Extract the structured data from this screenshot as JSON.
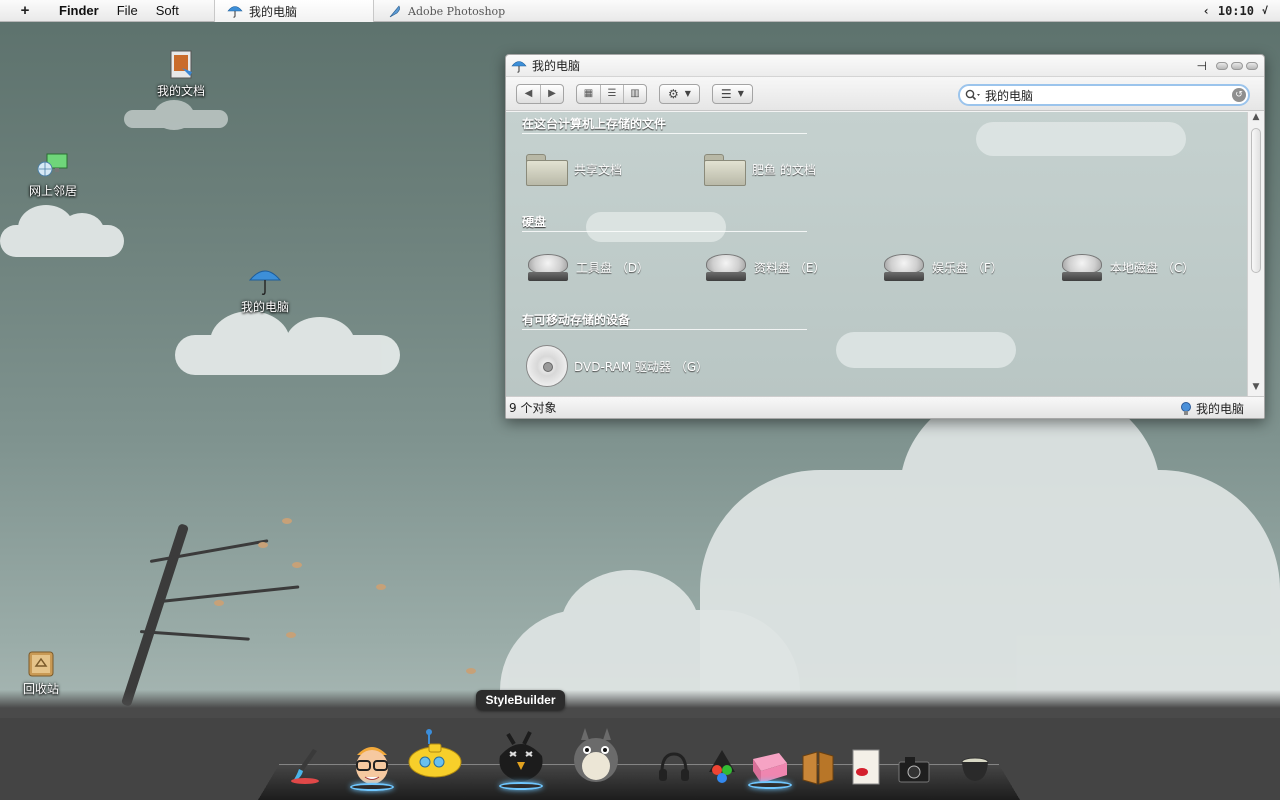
{
  "menubar": {
    "finder": "Finder",
    "file": "File",
    "soft": "Soft",
    "active_tab": "我的电脑",
    "inactive_tab": "Adobe Photoshop",
    "clock": "10:10"
  },
  "desktop": {
    "my_documents": "我的文档",
    "network": "网上邻居",
    "my_computer": "我的电脑",
    "recycle_bin": "回收站"
  },
  "window": {
    "title": "我的电脑",
    "search_value": "我的电脑",
    "sections": {
      "stored_files": "在这台计算机上存储的文件",
      "hard_drives": "硬盘",
      "removable": "有可移动存储的设备"
    },
    "folders": [
      "共享文档",
      "肥鱼 的文档"
    ],
    "drives": [
      "工具盘 （D）",
      "资料盘 （E）",
      "娱乐盘 （F）",
      "本地磁盘 （C）"
    ],
    "removable_devices": [
      "DVD-RAM 驱动器 （G）"
    ],
    "status_count": "9 个对象",
    "status_location": "我的电脑"
  },
  "dock": {
    "tooltip": "StyleBuilder"
  },
  "colors": {
    "search_focus": "#9bc4ec",
    "dock_glow": "#6fc7ff"
  }
}
